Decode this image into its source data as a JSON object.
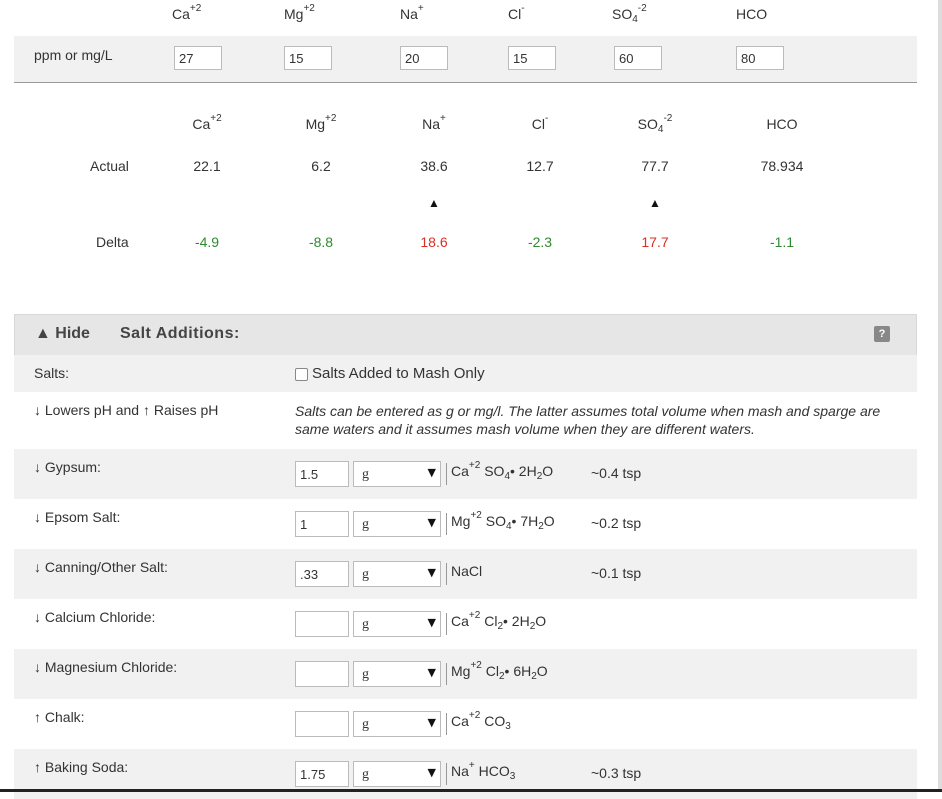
{
  "ions_top": {
    "headers": [
      {
        "base": "Ca",
        "sup": "+2",
        "sub": ""
      },
      {
        "base": "Mg",
        "sup": "+2",
        "sub": ""
      },
      {
        "base": "Na",
        "sup": "+",
        "sub": ""
      },
      {
        "base": "Cl",
        "sup": "-",
        "sub": ""
      },
      {
        "base": "SO",
        "sup": "-2",
        "sub": "4"
      },
      {
        "base": "HCO",
        "sup": "",
        "sub": ""
      }
    ],
    "unit_label": "ppm or mg/L",
    "values": [
      "27",
      "15",
      "20",
      "15",
      "60",
      "80"
    ]
  },
  "results": {
    "headers": [
      {
        "base": "Ca",
        "sup": "+2",
        "sub": ""
      },
      {
        "base": "Mg",
        "sup": "+2",
        "sub": ""
      },
      {
        "base": "Na",
        "sup": "+",
        "sub": ""
      },
      {
        "base": "Cl",
        "sup": "-",
        "sub": ""
      },
      {
        "base": "SO",
        "sup": "-2",
        "sub": "4"
      },
      {
        "base": "HCO",
        "sup": "",
        "sub": ""
      }
    ],
    "actual_label": "Actual",
    "actual": [
      "22.1",
      "6.2",
      "38.6",
      "12.7",
      "77.7",
      "78.934"
    ],
    "arrows": [
      "",
      "",
      "▲",
      "",
      "▲",
      ""
    ],
    "delta_label": "Delta",
    "delta": [
      "-4.9",
      "-8.8",
      "18.6",
      "-2.3",
      "17.7",
      "-1.1"
    ],
    "delta_status": [
      "low",
      "low",
      "high",
      "low",
      "high",
      "low"
    ]
  },
  "salt_panel": {
    "hide_label": "▲ Hide",
    "title": "Salt Additions:",
    "help_label": "?",
    "salts_label": "Salts:",
    "mash_only_label": "Salts Added to Mash Only",
    "legend_label": "↓ Lowers pH and ↑ Raises pH",
    "note": "Salts can be entered as g or mg/l. The latter assumes total volume when mash and sparge are same waters and it assumes mash volume when they are different waters.",
    "salts": [
      {
        "name": "↓ Gypsum:",
        "amount": "1.5",
        "unit": "g",
        "formula_html": "Ca<sup>+2</sup> SO<sub>4</sub>• 2H<sub>2</sub>O",
        "tsp": "~0.4 tsp"
      },
      {
        "name": "↓ Epsom Salt:",
        "amount": "1",
        "unit": "g",
        "formula_html": "Mg<sup>+2</sup> SO<sub>4</sub>• 7H<sub>2</sub>O",
        "tsp": "~0.2 tsp"
      },
      {
        "name": "↓ Canning/Other Salt:",
        "amount": ".33",
        "unit": "g",
        "formula_html": "NaCl",
        "tsp": "~0.1 tsp"
      },
      {
        "name": "↓ Calcium Chloride:",
        "amount": "",
        "unit": "g",
        "formula_html": "Ca<sup>+2</sup> Cl<sub>2</sub>• 2H<sub>2</sub>O",
        "tsp": ""
      },
      {
        "name": "↓ Magnesium Chloride:",
        "amount": "",
        "unit": "g",
        "formula_html": "Mg<sup>+2</sup> Cl<sub>2</sub>• 6H<sub>2</sub>O",
        "tsp": ""
      },
      {
        "name": "↑ Chalk:",
        "amount": "",
        "unit": "g",
        "formula_html": "Ca<sup>+2</sup> CO<sub>3</sub>",
        "tsp": ""
      },
      {
        "name": "↑ Baking Soda:",
        "amount": "1.75",
        "unit": "g",
        "formula_html": "Na<sup>+</sup> HCO<sub>3</sub>",
        "tsp": "~0.3 tsp"
      }
    ]
  },
  "colors": {
    "low": "#2f8a2f",
    "high": "#d93025"
  }
}
